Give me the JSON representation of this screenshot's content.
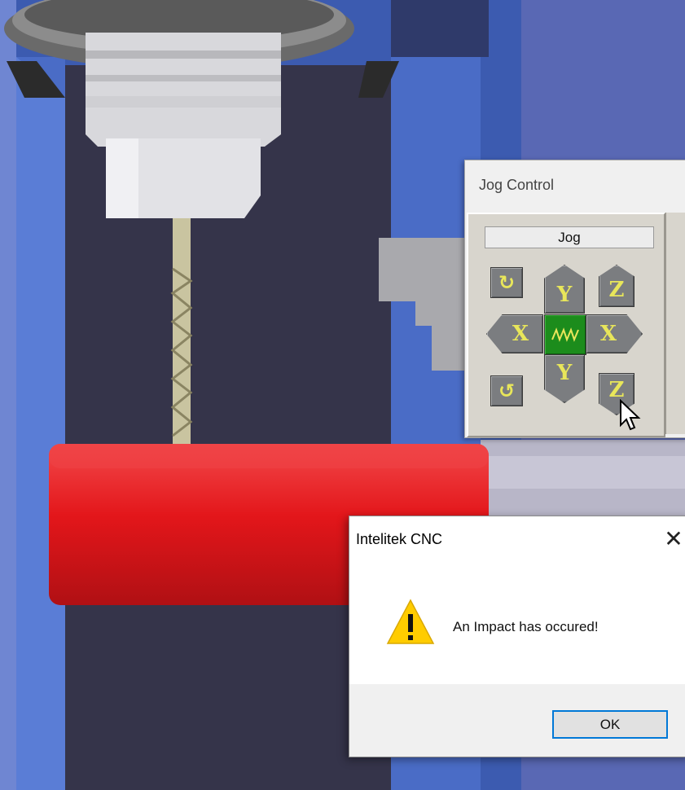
{
  "jog_window": {
    "title": "Jog Control",
    "panel_label": "Jog",
    "buttons": {
      "rotate_cw": "↻",
      "rotate_ccw": "↺",
      "y_plus": "Y",
      "y_minus": "Y",
      "x_minus": "X",
      "x_plus": "X",
      "z_up": "Z",
      "z_down": "Z",
      "center": "wave-icon"
    }
  },
  "dialog": {
    "title": "Intelitek CNC",
    "close_glyph": "✕",
    "message": "An Impact has occured!",
    "icon": "warning-icon",
    "ok_label": "OK"
  },
  "colors": {
    "machine_blue": "#3c5bb0",
    "workpiece_red": "#e3161a",
    "center_button_green": "#1c8c1c",
    "button_text_yellow": "#e8e65a",
    "dialog_accent": "#0078d7"
  }
}
